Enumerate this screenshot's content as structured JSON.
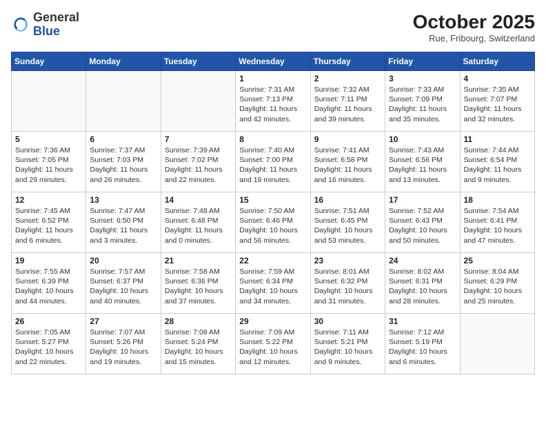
{
  "header": {
    "logo_general": "General",
    "logo_blue": "Blue",
    "month_title": "October 2025",
    "location": "Rue, Fribourg, Switzerland"
  },
  "weekdays": [
    "Sunday",
    "Monday",
    "Tuesday",
    "Wednesday",
    "Thursday",
    "Friday",
    "Saturday"
  ],
  "weeks": [
    [
      {
        "day": "",
        "info": ""
      },
      {
        "day": "",
        "info": ""
      },
      {
        "day": "",
        "info": ""
      },
      {
        "day": "1",
        "info": "Sunrise: 7:31 AM\nSunset: 7:13 PM\nDaylight: 11 hours and 42 minutes."
      },
      {
        "day": "2",
        "info": "Sunrise: 7:32 AM\nSunset: 7:11 PM\nDaylight: 11 hours and 39 minutes."
      },
      {
        "day": "3",
        "info": "Sunrise: 7:33 AM\nSunset: 7:09 PM\nDaylight: 11 hours and 35 minutes."
      },
      {
        "day": "4",
        "info": "Sunrise: 7:35 AM\nSunset: 7:07 PM\nDaylight: 11 hours and 32 minutes."
      }
    ],
    [
      {
        "day": "5",
        "info": "Sunrise: 7:36 AM\nSunset: 7:05 PM\nDaylight: 11 hours and 29 minutes."
      },
      {
        "day": "6",
        "info": "Sunrise: 7:37 AM\nSunset: 7:03 PM\nDaylight: 11 hours and 26 minutes."
      },
      {
        "day": "7",
        "info": "Sunrise: 7:39 AM\nSunset: 7:02 PM\nDaylight: 11 hours and 22 minutes."
      },
      {
        "day": "8",
        "info": "Sunrise: 7:40 AM\nSunset: 7:00 PM\nDaylight: 11 hours and 19 minutes."
      },
      {
        "day": "9",
        "info": "Sunrise: 7:41 AM\nSunset: 6:58 PM\nDaylight: 11 hours and 16 minutes."
      },
      {
        "day": "10",
        "info": "Sunrise: 7:43 AM\nSunset: 6:56 PM\nDaylight: 11 hours and 13 minutes."
      },
      {
        "day": "11",
        "info": "Sunrise: 7:44 AM\nSunset: 6:54 PM\nDaylight: 11 hours and 9 minutes."
      }
    ],
    [
      {
        "day": "12",
        "info": "Sunrise: 7:45 AM\nSunset: 6:52 PM\nDaylight: 11 hours and 6 minutes."
      },
      {
        "day": "13",
        "info": "Sunrise: 7:47 AM\nSunset: 6:50 PM\nDaylight: 11 hours and 3 minutes."
      },
      {
        "day": "14",
        "info": "Sunrise: 7:48 AM\nSunset: 6:48 PM\nDaylight: 11 hours and 0 minutes."
      },
      {
        "day": "15",
        "info": "Sunrise: 7:50 AM\nSunset: 6:46 PM\nDaylight: 10 hours and 56 minutes."
      },
      {
        "day": "16",
        "info": "Sunrise: 7:51 AM\nSunset: 6:45 PM\nDaylight: 10 hours and 53 minutes."
      },
      {
        "day": "17",
        "info": "Sunrise: 7:52 AM\nSunset: 6:43 PM\nDaylight: 10 hours and 50 minutes."
      },
      {
        "day": "18",
        "info": "Sunrise: 7:54 AM\nSunset: 6:41 PM\nDaylight: 10 hours and 47 minutes."
      }
    ],
    [
      {
        "day": "19",
        "info": "Sunrise: 7:55 AM\nSunset: 6:39 PM\nDaylight: 10 hours and 44 minutes."
      },
      {
        "day": "20",
        "info": "Sunrise: 7:57 AM\nSunset: 6:37 PM\nDaylight: 10 hours and 40 minutes."
      },
      {
        "day": "21",
        "info": "Sunrise: 7:58 AM\nSunset: 6:36 PM\nDaylight: 10 hours and 37 minutes."
      },
      {
        "day": "22",
        "info": "Sunrise: 7:59 AM\nSunset: 6:34 PM\nDaylight: 10 hours and 34 minutes."
      },
      {
        "day": "23",
        "info": "Sunrise: 8:01 AM\nSunset: 6:32 PM\nDaylight: 10 hours and 31 minutes."
      },
      {
        "day": "24",
        "info": "Sunrise: 8:02 AM\nSunset: 6:31 PM\nDaylight: 10 hours and 28 minutes."
      },
      {
        "day": "25",
        "info": "Sunrise: 8:04 AM\nSunset: 6:29 PM\nDaylight: 10 hours and 25 minutes."
      }
    ],
    [
      {
        "day": "26",
        "info": "Sunrise: 7:05 AM\nSunset: 5:27 PM\nDaylight: 10 hours and 22 minutes."
      },
      {
        "day": "27",
        "info": "Sunrise: 7:07 AM\nSunset: 5:26 PM\nDaylight: 10 hours and 19 minutes."
      },
      {
        "day": "28",
        "info": "Sunrise: 7:08 AM\nSunset: 5:24 PM\nDaylight: 10 hours and 15 minutes."
      },
      {
        "day": "29",
        "info": "Sunrise: 7:09 AM\nSunset: 5:22 PM\nDaylight: 10 hours and 12 minutes."
      },
      {
        "day": "30",
        "info": "Sunrise: 7:11 AM\nSunset: 5:21 PM\nDaylight: 10 hours and 9 minutes."
      },
      {
        "day": "31",
        "info": "Sunrise: 7:12 AM\nSunset: 5:19 PM\nDaylight: 10 hours and 6 minutes."
      },
      {
        "day": "",
        "info": ""
      }
    ]
  ]
}
